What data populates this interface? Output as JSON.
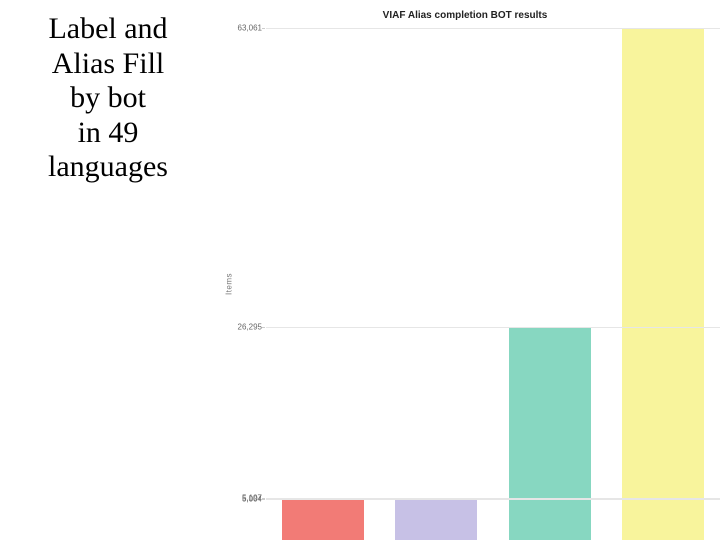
{
  "text_block": {
    "line1": "Label and",
    "line2": "Alias Fill",
    "line3": "by bot",
    "line4": "in 49",
    "line5": "languages"
  },
  "chart_data": {
    "type": "bar",
    "title": "VIAF Alias completion BOT results",
    "ylabel": "Items",
    "xlabel": "",
    "yticks": [
      5004,
      5197,
      26295,
      63061
    ],
    "ylim": [
      0,
      63061
    ],
    "categories": [
      "",
      "",
      "",
      ""
    ],
    "values": [
      5004,
      5197,
      26295,
      63061
    ],
    "colors": [
      "#f27b76",
      "#c7c1e6",
      "#87d7c1",
      "#f8f49c"
    ]
  }
}
